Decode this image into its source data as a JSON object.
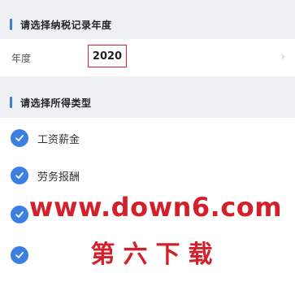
{
  "section1": {
    "title": "请选择纳税记录年度"
  },
  "year_row": {
    "label": "年度",
    "value": "2020",
    "chevron": "›"
  },
  "section2": {
    "title": "请选择所得类型"
  },
  "income_types": [
    {
      "label": "工资薪金",
      "checked": true
    },
    {
      "label": "劳务报酬",
      "checked": true
    },
    {
      "label": "",
      "checked": true
    },
    {
      "label": "",
      "checked": true
    }
  ],
  "watermark": {
    "url": "www.down6.com",
    "text": "第六下载"
  },
  "colors": {
    "accent": "#3d7fe0",
    "highlight_border": "#d8222b",
    "watermark": "#d4202a",
    "background": "#eef0f4"
  }
}
